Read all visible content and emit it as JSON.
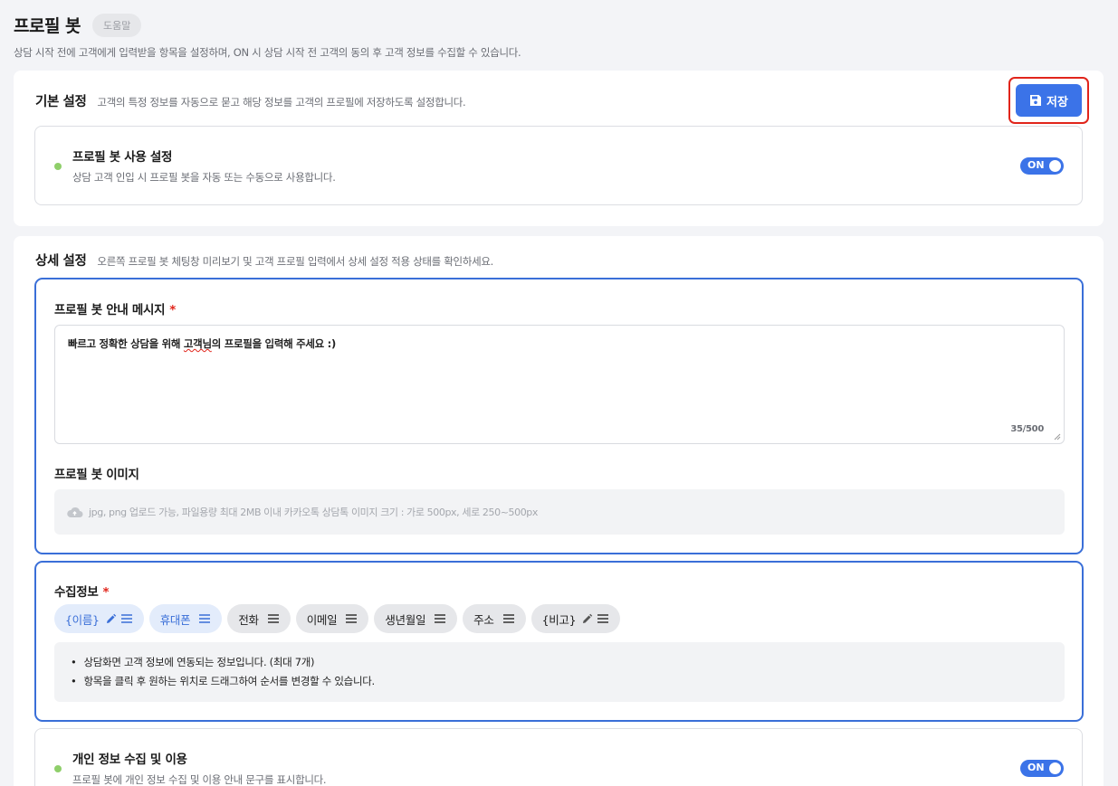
{
  "header": {
    "title": "프로필 봇",
    "help_label": "도움말",
    "description": "상담 시작 전에 고객에게 입력받을 항목을 설정하며, ON 시 상담 시작 전 고객의 동의 후 고객 정보를 수집할 수 있습니다."
  },
  "basic": {
    "title": "기본 설정",
    "description": "고객의 특정 정보를 자동으로 묻고 해당 정보를 고객의 프로필에 저장하도록 설정합니다.",
    "save_label": "저장",
    "usage": {
      "title": "프로필 봇 사용 설정",
      "description": "상담 고객 인입 시 프로필 봇을 자동 또는 수동으로 사용합니다.",
      "toggle": "ON"
    }
  },
  "detail": {
    "title": "상세 설정",
    "description": "오른쪽 프로필 봇 체팅창 미리보기 및 고객 프로필 입력에서 상세 설정 적용 상태를 확인하세요.",
    "message": {
      "label": "프로필 봇 안내 메시지",
      "required": "*",
      "text_before": "빠르고 정확한 상담을 위해 ",
      "text_spell": "고객님",
      "text_after": "의 프로필을 입력해 주세요 :)",
      "count": "35/500"
    },
    "image": {
      "label": "프로필 봇 이미지",
      "hint": "jpg, png 업로드 가능, 파일용량 최대 2MB 이내 카카오톡 상담톡 이미지 크기 : 가로 500px, 세로 250~500px"
    },
    "collect": {
      "label": "수집정보",
      "required": "*",
      "chips": [
        {
          "label": "{이름}",
          "active": true,
          "editable": true
        },
        {
          "label": "휴대폰",
          "active": true,
          "editable": false
        },
        {
          "label": "전화",
          "active": false,
          "editable": false
        },
        {
          "label": "이메일",
          "active": false,
          "editable": false
        },
        {
          "label": "생년월일",
          "active": false,
          "editable": false
        },
        {
          "label": "주소",
          "active": false,
          "editable": false
        },
        {
          "label": "{비고}",
          "active": false,
          "editable": true
        }
      ],
      "notes": [
        "상담화면 고객 정보에 연동되는 정보입니다. (최대 7개)",
        "항목을 클릭 후 원하는 위치로 드래그하여 순서를 변경할 수 있습니다."
      ]
    },
    "privacy": {
      "title": "개인 정보 수집 및 이용",
      "description": "프로필 봇에 개인 정보 수집 및 이용 안내 문구를 표시합니다.",
      "toggle": "ON"
    }
  },
  "colors": {
    "accent": "#3b73e8",
    "highlight_border": "#e1251b",
    "status_dot": "#8fcf6a"
  }
}
